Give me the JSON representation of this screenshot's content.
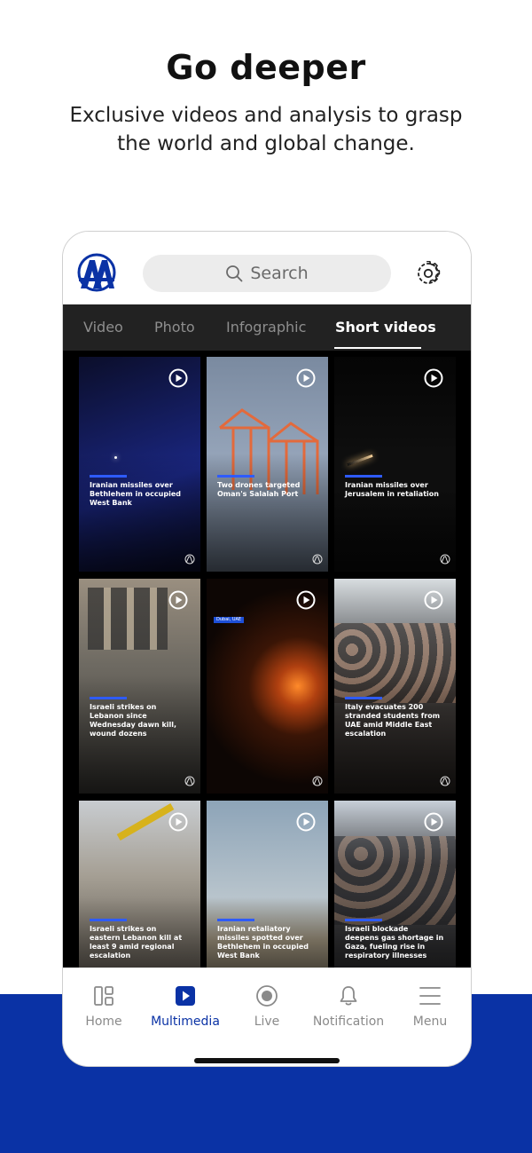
{
  "promo": {
    "headline": "Go deeper",
    "subline": "Exclusive videos and analysis to grasp the world and global change."
  },
  "header": {
    "search_placeholder": "Search"
  },
  "tabs": [
    {
      "label": "Video"
    },
    {
      "label": "Photo"
    },
    {
      "label": "Infographic"
    },
    {
      "label": "Short videos",
      "active": true
    }
  ],
  "videos": [
    {
      "caption": "Iranian missiles over Bethlehem in occupied West Bank"
    },
    {
      "caption": "Two drones targeted Oman's Salalah Port"
    },
    {
      "caption": "Iranian missiles over Jerusalem in retaliation"
    },
    {
      "caption": "Israeli strikes on Lebanon since Wednesday dawn kill, wound dozens"
    },
    {
      "caption": "",
      "tag": "Dubai, UAE"
    },
    {
      "caption": "Italy evacuates 200 stranded students from UAE amid Middle East escalation"
    },
    {
      "caption": "Israeli strikes on eastern Lebanon kill at least 9 amid regional escalation"
    },
    {
      "caption": "Iranian retaliatory missiles spotted over Bethlehem in occupied West Bank"
    },
    {
      "caption": "Israeli blockade deepens gas shortage in Gaza, fueling rise in respiratory illnesses"
    }
  ],
  "bottom_nav": [
    {
      "label": "Home",
      "icon": "home-grid-icon"
    },
    {
      "label": "Multimedia",
      "icon": "play-square-icon",
      "active": true
    },
    {
      "label": "Live",
      "icon": "live-record-icon"
    },
    {
      "label": "Notification",
      "icon": "bell-icon"
    },
    {
      "label": "Menu",
      "icon": "hamburger-icon"
    }
  ],
  "colors": {
    "brand_blue": "#0a32a5",
    "tab_bar_bg": "#222222",
    "caption_bar": "#2e5bff"
  }
}
